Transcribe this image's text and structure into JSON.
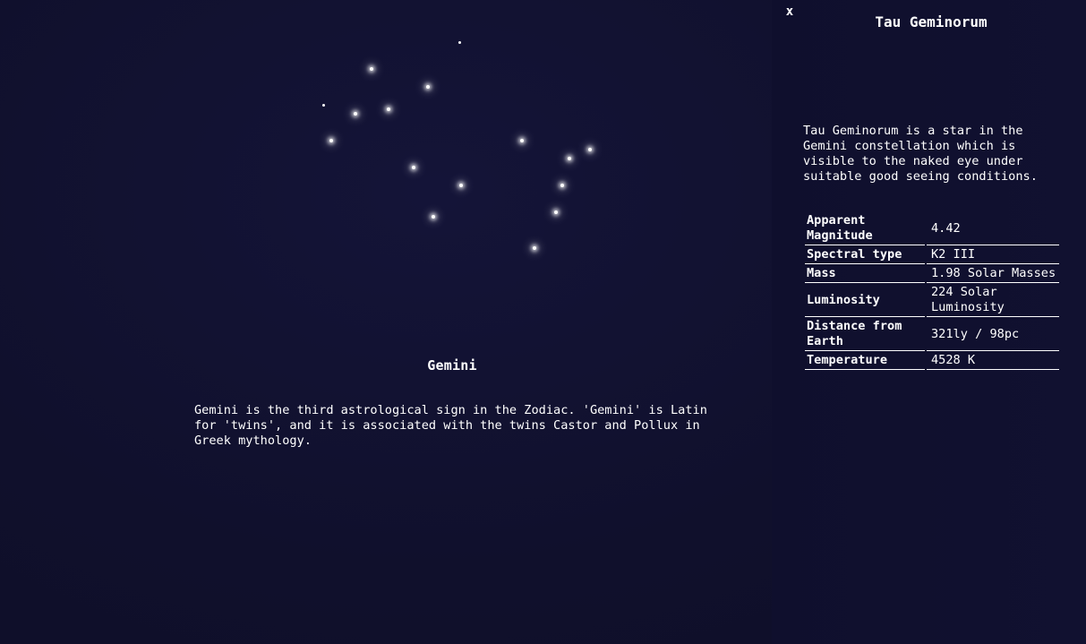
{
  "constellation": {
    "name": "Gemini",
    "description": "Gemini is the third astrological sign in the Zodiac. 'Gemini' is Latin for 'twins', and it is associated with the twins Castor and Pollux in Greek mythology."
  },
  "panel": {
    "close_label": "x",
    "star_name": "Tau Geminorum",
    "star_description": "Tau Geminorum is a star in the Gemini constellation which is visible to the naked eye under suitable good seeing conditions.",
    "properties": [
      {
        "key": "Apparent Magnitude",
        "value": "4.42"
      },
      {
        "key": "Spectral type",
        "value": "K2 III"
      },
      {
        "key": "Mass",
        "value": "1.98 Solar Masses"
      },
      {
        "key": "Luminosity",
        "value": "224 Solar Luminosity"
      },
      {
        "key": "Distance from Earth",
        "value": "321ly / 98pc"
      },
      {
        "key": "Temperature",
        "value": "4528 K"
      }
    ]
  },
  "colors": {
    "background": "#121233",
    "panel": "#101030",
    "text": "#ffffff"
  }
}
